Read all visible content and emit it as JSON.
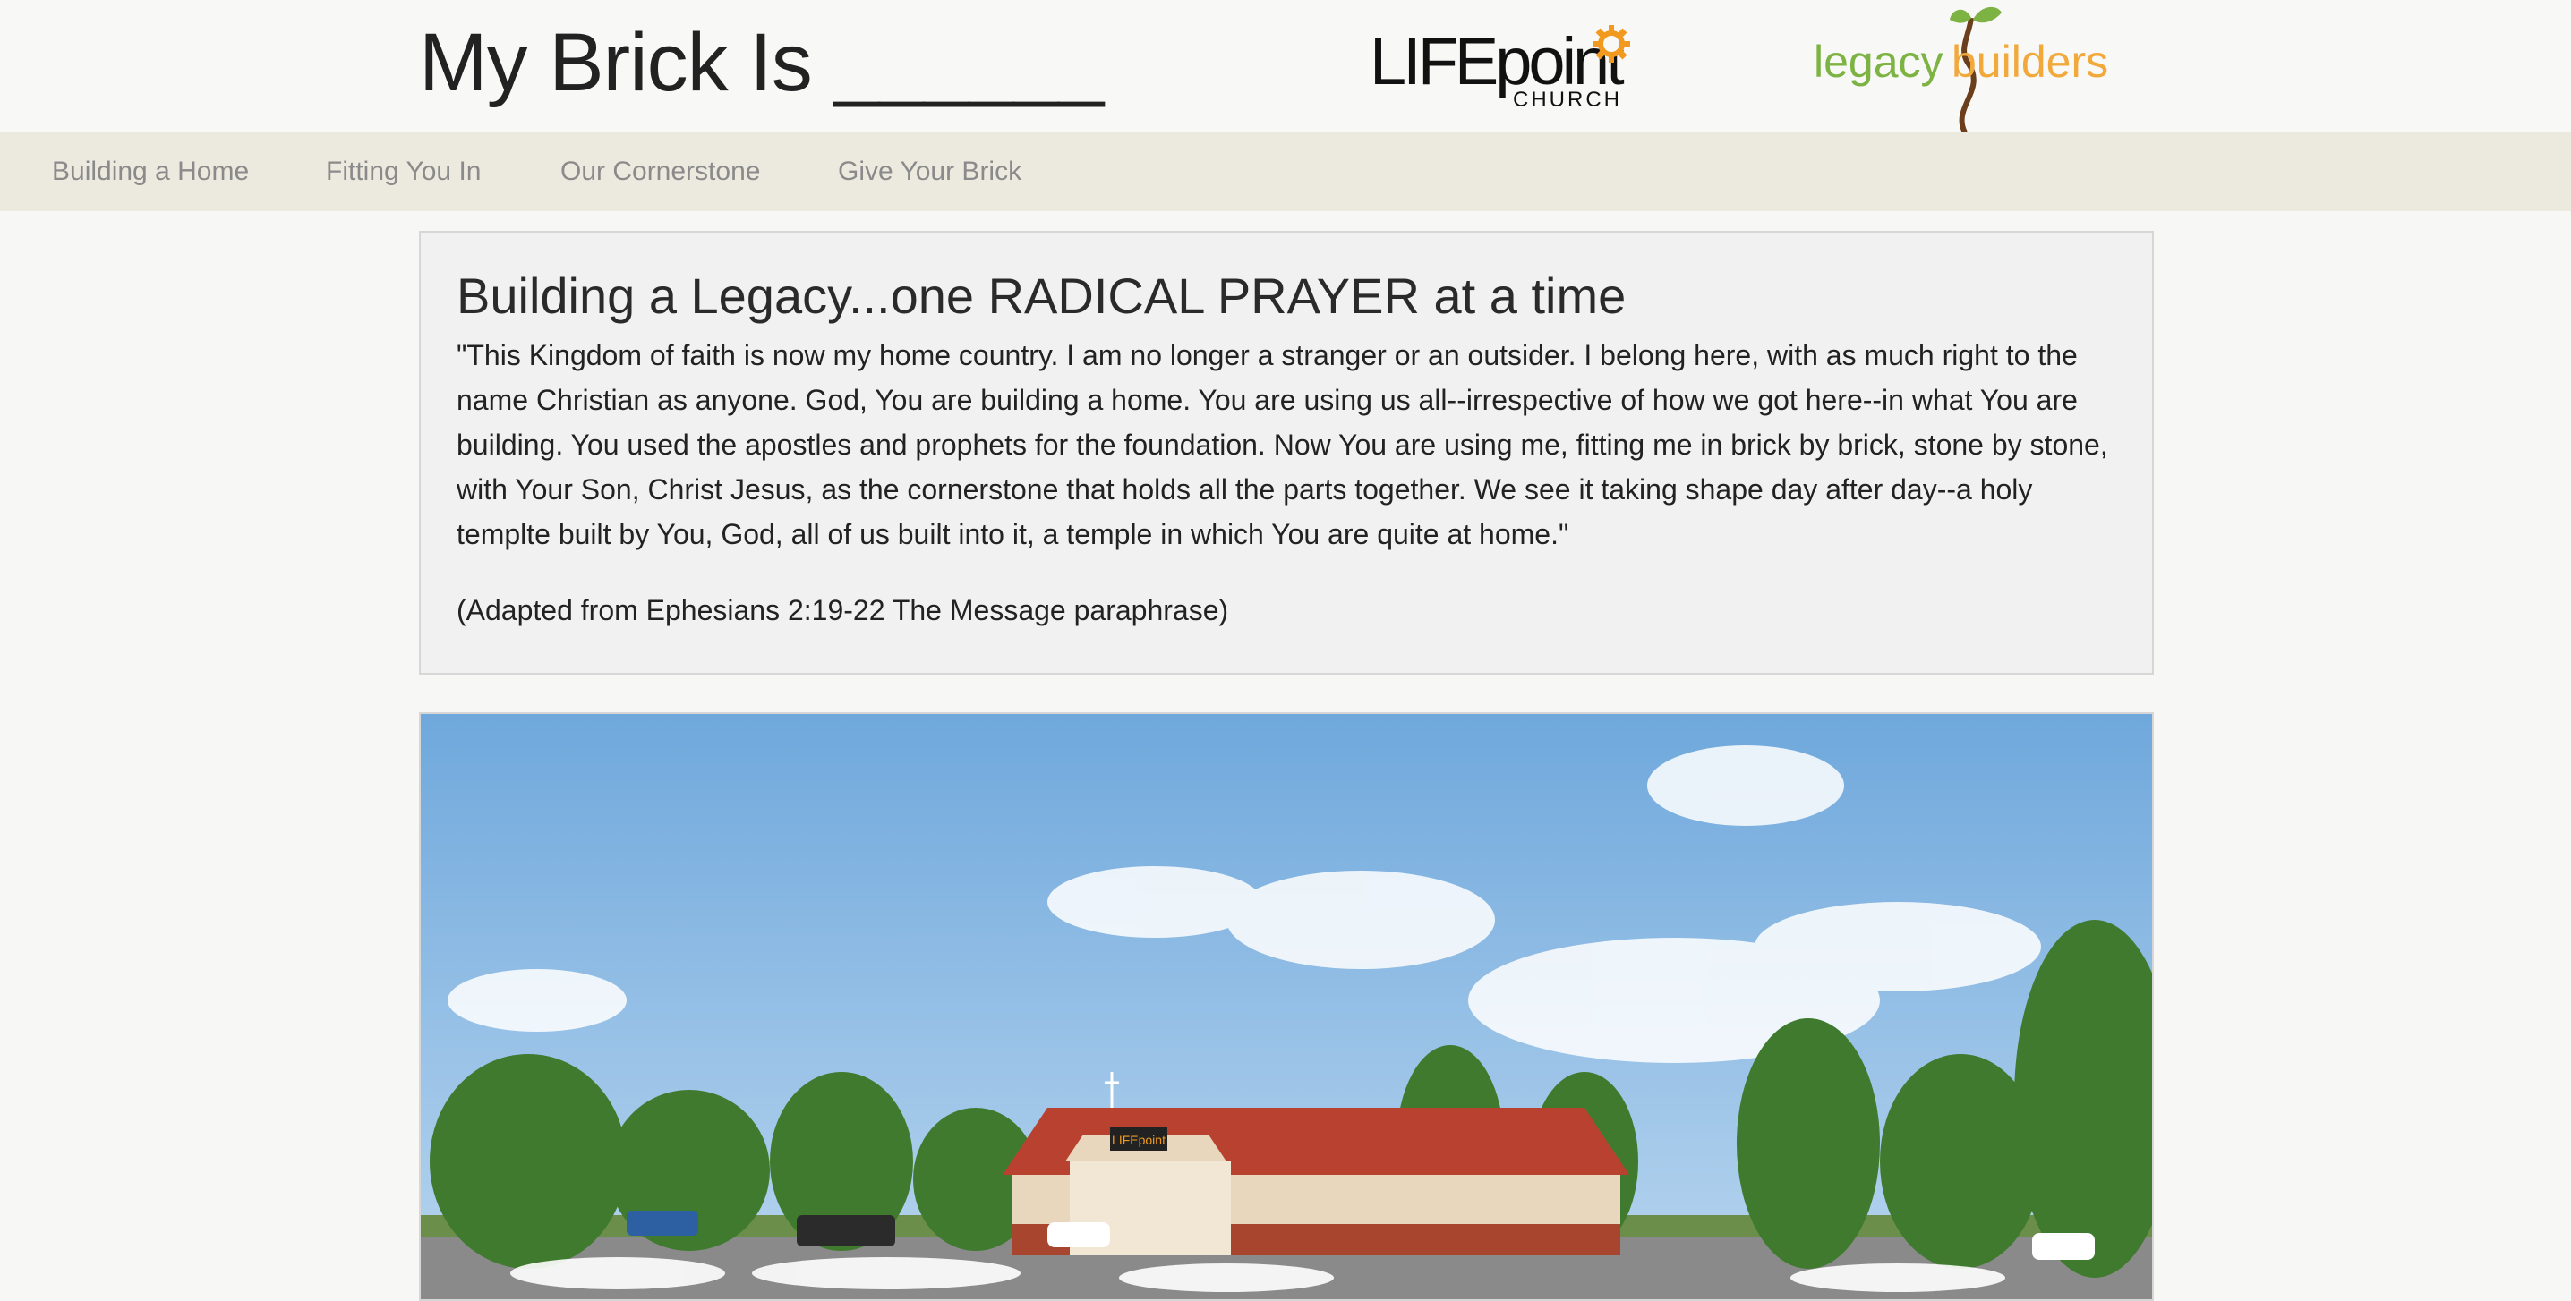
{
  "header": {
    "site_title": "My Brick Is ______",
    "logo_lifepoint": {
      "main": "LIFEpoint",
      "sub": "CHURCH"
    },
    "logo_legacy": {
      "word1": "legacy",
      "word2": "builders"
    }
  },
  "nav": {
    "items": [
      {
        "label": "Building a Home"
      },
      {
        "label": "Fitting You In"
      },
      {
        "label": "Our Cornerstone"
      },
      {
        "label": "Give Your Brick"
      }
    ]
  },
  "main": {
    "title": "Building a Legacy...one RADICAL PRAYER at a time",
    "quote": "\"This Kingdom of faith is now my home country. I am no longer a stranger or an outsider. I belong here, with as much right to the name Christian as anyone. God, You are building a home. You are using us all--irrespective of how we got here--in what You are building. You used the apostles and prophets for the foundation. Now You are using me, fitting me in brick by brick, stone by stone, with Your Son, Christ Jesus, as the cornerstone that holds all the parts together. We see it taking shape day after day--a holy templte built by You, God, all of us built into it, a temple in which You are quite at home.\"",
    "source": "(Adapted from Ephesians 2:19-22 The Message paraphrase)",
    "hero_sign": "LIFEpoint"
  },
  "colors": {
    "nav_bg": "#ece9df",
    "nav_text": "#8a8a8a",
    "legacy_green": "#7cb342",
    "legacy_orange": "#f2a93b",
    "lifepoint_accent": "#f29a1f",
    "roof_red": "#b8412f"
  }
}
